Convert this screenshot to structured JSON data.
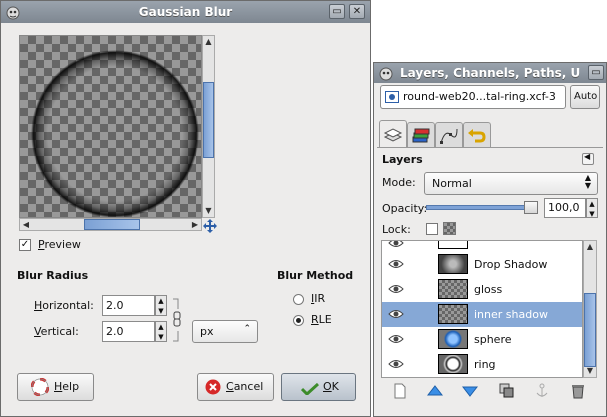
{
  "dialog": {
    "title": "Gaussian Blur",
    "preview_label": "Preview",
    "blur_radius_heading": "Blur Radius",
    "horizontal_label": "Horizontal:",
    "horizontal_value": "2.0",
    "vertical_label": "Vertical:",
    "vertical_value": "2.0",
    "unit": "px",
    "blur_method_heading": "Blur Method",
    "method_iir": "IIR",
    "method_rle": "RLE",
    "help_label": "Help",
    "cancel_label": "Cancel",
    "ok_label": "OK"
  },
  "layers_window": {
    "title": "Layers, Channels, Paths, U",
    "image_combo": "round-web20...tal-ring.xcf-3",
    "auto_label": "Auto",
    "section_title": "Layers",
    "mode_label": "Mode:",
    "mode_value": "Normal",
    "opacity_label": "Opacity:",
    "opacity_value": "100,0",
    "opacity_level": 1.0,
    "lock_label": "Lock:",
    "layers": [
      {
        "name": "Drop Shadow"
      },
      {
        "name": "gloss"
      },
      {
        "name": "inner shadow"
      },
      {
        "name": "sphere"
      },
      {
        "name": "ring"
      }
    ],
    "selected_layer": "inner shadow"
  },
  "colors": {
    "selection": "#86a8d6",
    "title_bar": "#8a939c"
  }
}
